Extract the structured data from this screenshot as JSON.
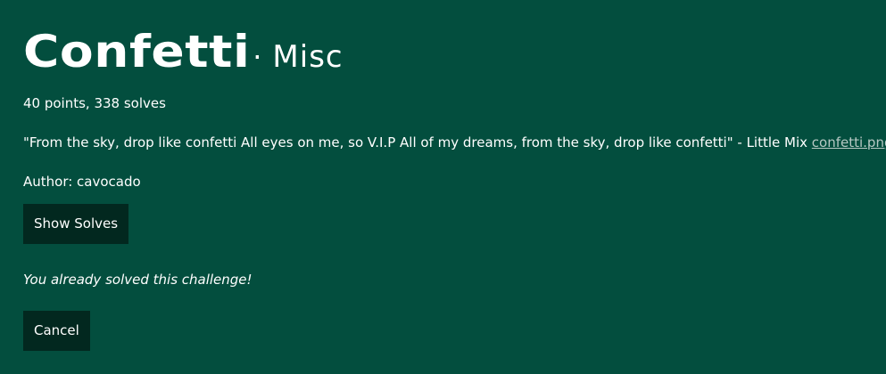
{
  "challenge": {
    "name": "Confetti",
    "separator": "·",
    "category": "Misc",
    "stats": "40 points, 338 solves",
    "description": "\"From the sky, drop like confetti All eyes on me, so V.I.P All of my dreams, from the sky, drop like confetti\" - Little Mix",
    "attachment": "confetti.png",
    "author": "Author: cavocado"
  },
  "actions": {
    "show_solves_label": "Show Solves",
    "solved_message": "You already solved this challenge!",
    "cancel_label": "Cancel"
  },
  "colors": {
    "background": "#034e3e",
    "button": "#02281f",
    "link": "#b7c8c3"
  }
}
